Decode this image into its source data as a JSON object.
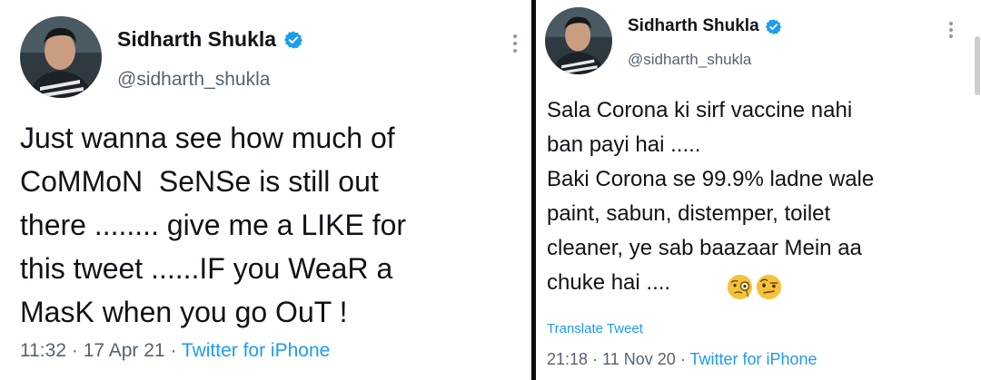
{
  "left_tweet": {
    "display_name": "Sidharth Shukla",
    "handle": "@sidharth_shukla",
    "text": "Just wanna see how much of\nCoMMoN  SeNSe is still out\nthere ........ give me a LIKE for\nthis tweet ......IF you WeaR a\nMasK when you go OuT !",
    "time": "11:32",
    "separator": "·",
    "date": "17 Apr 21",
    "source": "Twitter for iPhone"
  },
  "right_tweet": {
    "display_name": "Sidharth Shukla",
    "handle": "@sidharth_shukla",
    "text": "Sala Corona ki sirf vaccine nahi\nban payi hai .....\nBaki Corona se 99.9% ladne wale\npaint, sabun, distemper, toilet\ncleaner, ye sab baazaar Mein aa\nchuke hai ....",
    "emojis": [
      "face-with-monocle-icon",
      "face-with-raised-eyebrow-icon"
    ],
    "translate_label": "Translate Tweet",
    "time": "21:18",
    "separator": "·",
    "date": "11 Nov 20",
    "source": "Twitter for iPhone"
  },
  "colors": {
    "text": "#0f1419",
    "secondary": "#536471",
    "link": "#1d9bf0",
    "verified": "#1d9bf0",
    "divider": "#0b0b10"
  }
}
